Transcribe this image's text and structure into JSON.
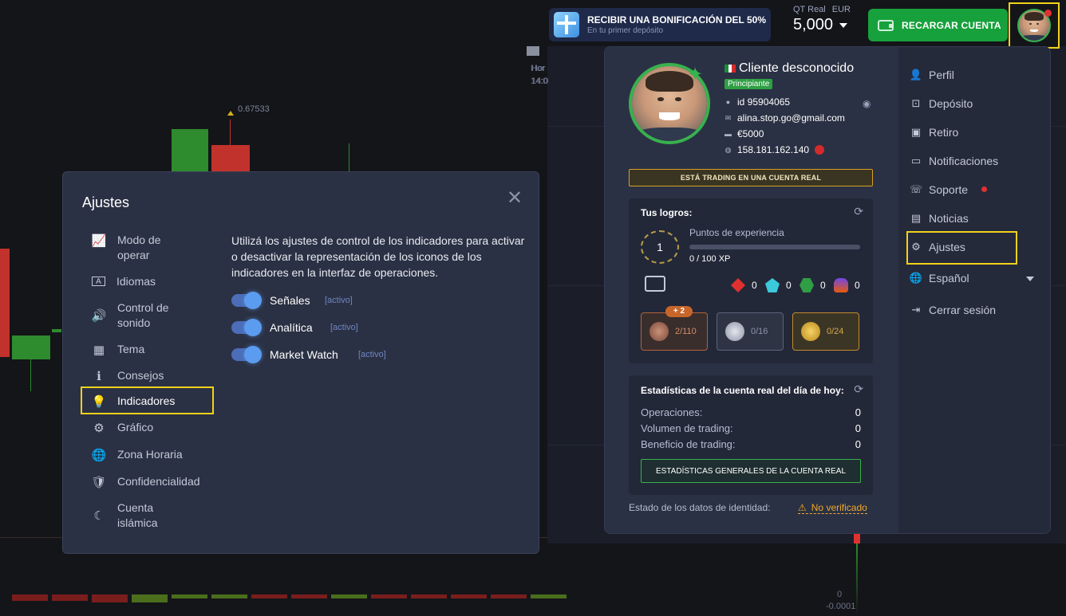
{
  "chart": {
    "price_label": "0.67533",
    "hour_label": "Hor",
    "time_label": "14:0",
    "right_zero": "0",
    "right_neg": "-0.0001"
  },
  "topbar": {
    "bonus_title": "RECIBIR UNA BONIFICACIÓN DEL 50%",
    "bonus_subtitle": "En tu primer depósito",
    "account_type": "QT Real",
    "currency": "EUR",
    "balance": "5,000",
    "recharge_label": "RECARGAR CUENTA"
  },
  "settings": {
    "title": "Ajustes",
    "close": "✕",
    "menu": [
      {
        "label": "Modo de",
        "label2": "operar"
      },
      {
        "label": "Idiomas"
      },
      {
        "label": "Control de",
        "label2": "sonido"
      },
      {
        "label": "Tema"
      },
      {
        "label": "Consejos"
      },
      {
        "label": "Indicadores"
      },
      {
        "label": "Gráfico"
      },
      {
        "label": "Zona Horaria"
      },
      {
        "label": "Confidencialidad"
      },
      {
        "label": "Cuenta",
        "label2": "islámica"
      }
    ],
    "description": "Utilizá los ajustes de control de los indicadores para activar o desactivar la representación de los iconos de los indicadores en la interfaz de operaciones.",
    "toggles": [
      {
        "label": "Señales",
        "status": "[activo]"
      },
      {
        "label": "Analítica",
        "status": "[activo]"
      },
      {
        "label": "Market Watch",
        "status": "[activo]"
      }
    ]
  },
  "profile": {
    "name": "Cliente desconocido",
    "level": "Principiante",
    "id": "id 95904065",
    "email": "alina.stop.go@gmail.com",
    "balance": "€5000",
    "ip": "158.181.162.140",
    "real_banner": "ESTÁ TRADING EN UNA CUENTA REAL",
    "achievements": {
      "title": "Tus logros:",
      "level": "1",
      "xp_label": "Puntos de experiencia",
      "xp_value": "0 / 100 XP",
      "xp_fraction": 0,
      "gems": [
        "0",
        "0",
        "0",
        "0"
      ],
      "medals": [
        "2/110",
        "0/16",
        "0/24"
      ],
      "medal_bonus": "+ 2"
    },
    "stats": {
      "title": "Estadísticas de la cuenta real del día de hoy:",
      "rows": [
        {
          "label": "Operaciones:",
          "value": "0"
        },
        {
          "label": "Volumen de trading:",
          "value": "0"
        },
        {
          "label": "Beneficio de trading:",
          "value": "0"
        }
      ],
      "button": "ESTADÍSTICAS GENERALES DE LA CUENTA REAL"
    },
    "identity_label": "Estado de los datos de identidad:",
    "identity_status": "No verificado"
  },
  "nav": {
    "items": [
      {
        "label": "Perfil"
      },
      {
        "label": "Depósito"
      },
      {
        "label": "Retiro"
      },
      {
        "label": "Notificaciones"
      },
      {
        "label": "Soporte"
      },
      {
        "label": "Noticias"
      },
      {
        "label": "Ajustes"
      },
      {
        "label": "Español"
      },
      {
        "label": "Cerrar sesión"
      }
    ]
  },
  "colors": {
    "accent_green": "#37b24d",
    "highlight_yellow": "#f2d21a",
    "toggle_blue": "#5b9cf0",
    "warning": "#f0a92a"
  }
}
